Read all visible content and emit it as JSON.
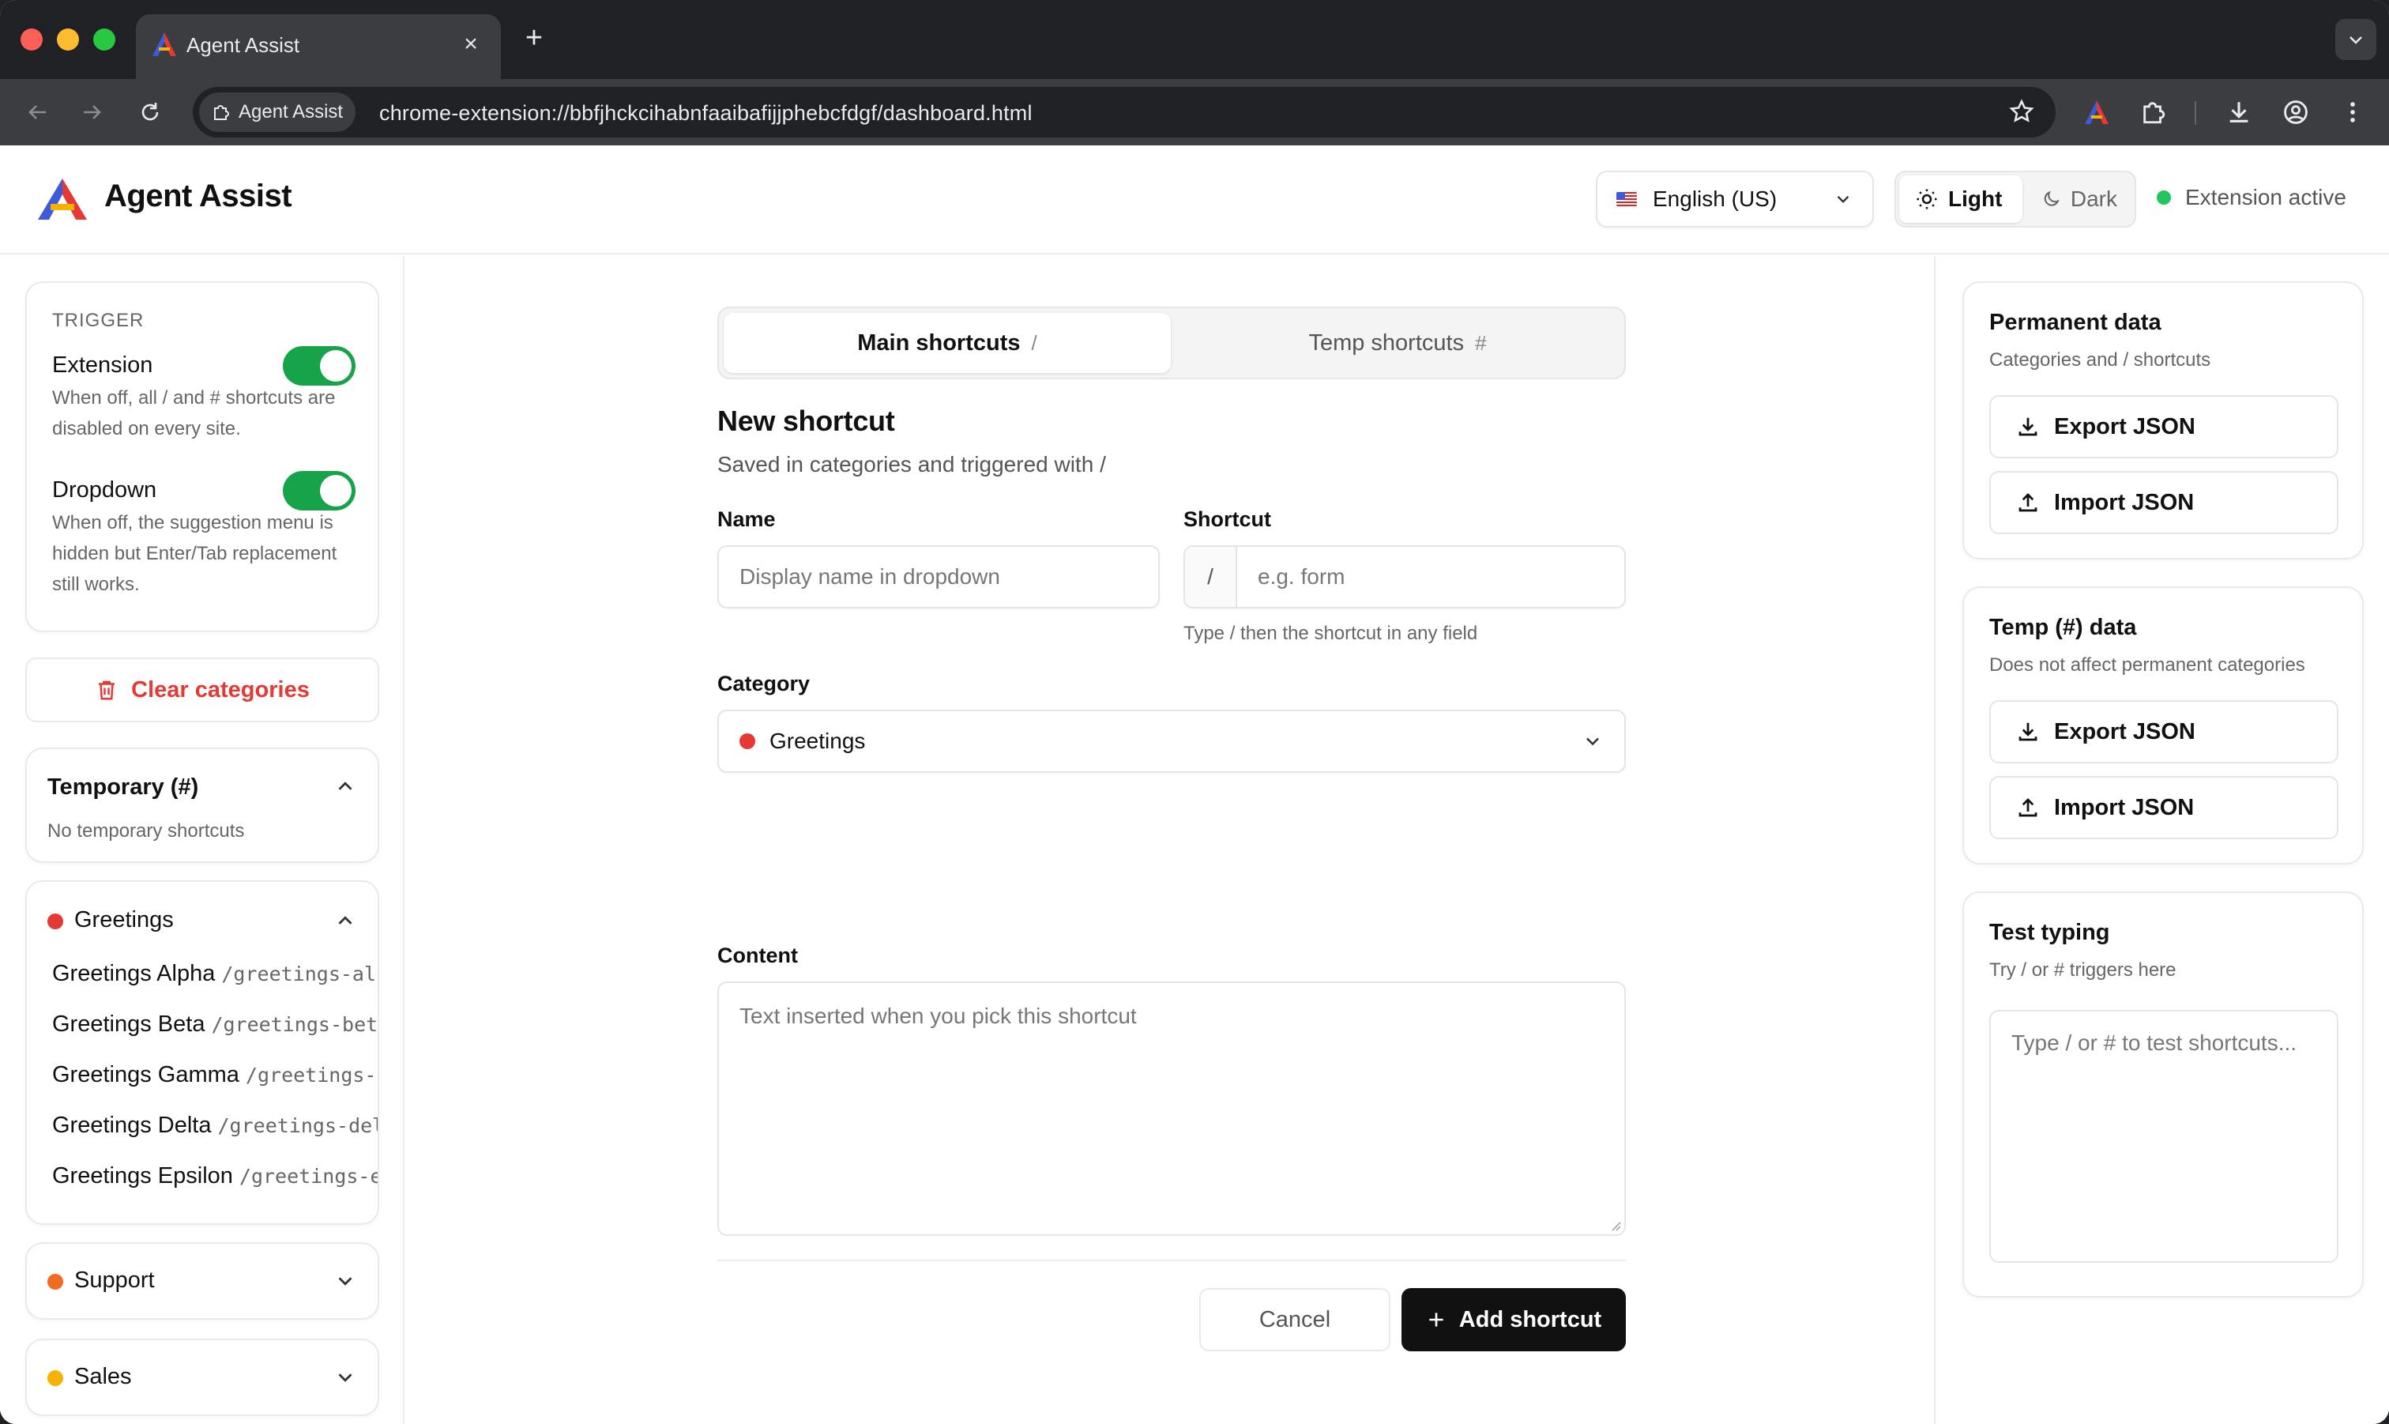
{
  "browser": {
    "tab_title": "Agent Assist",
    "ext_chip_label": "Agent Assist",
    "url": "chrome-extension://bbfjhckcihabnfaaibafijjphebcfdgf/dashboard.html"
  },
  "header": {
    "brand": "Agent Assist",
    "language": "English (US)",
    "theme_light": "Light",
    "theme_dark": "Dark",
    "status": "Extension active"
  },
  "sidebar": {
    "trigger_caption": "TRIGGER",
    "extension_label": "Extension",
    "extension_desc": "When off, all / and # shortcuts are disabled on every site.",
    "dropdown_label": "Dropdown",
    "dropdown_desc": "When off, the suggestion menu is hidden but Enter/Tab replacement still works.",
    "clear_label": "Clear categories",
    "temporary": {
      "title": "Temporary (#)",
      "empty": "No temporary shortcuts"
    },
    "categories": [
      {
        "name": "Greetings",
        "color": "#e53935",
        "expanded": true,
        "items": [
          {
            "name": "Greetings Alpha",
            "code": "/greetings-alpha"
          },
          {
            "name": "Greetings Beta",
            "code": "/greetings-beta"
          },
          {
            "name": "Greetings Gamma",
            "code": "/greetings-gamma"
          },
          {
            "name": "Greetings Delta",
            "code": "/greetings-delta"
          },
          {
            "name": "Greetings Epsilon",
            "code": "/greetings-epsilon"
          }
        ]
      },
      {
        "name": "Support",
        "color": "#f26b21",
        "expanded": false
      },
      {
        "name": "Sales",
        "color": "#f5b301",
        "expanded": false
      }
    ]
  },
  "main": {
    "tabs": [
      {
        "label": "Main shortcuts",
        "symbol": "/",
        "active": true
      },
      {
        "label": "Temp shortcuts",
        "symbol": "#",
        "active": false
      }
    ],
    "title": "New shortcut",
    "subtitle": "Saved in categories and triggered with /",
    "name_label": "Name",
    "name_placeholder": "Display name in dropdown",
    "shortcut_label": "Shortcut",
    "shortcut_prefix": "/",
    "shortcut_placeholder": "e.g. form",
    "shortcut_hint": "Type / then the shortcut in any field",
    "category_label": "Category",
    "category_value": "Greetings",
    "category_color": "#e53935",
    "content_label": "Content",
    "content_placeholder": "Text inserted when you pick this shortcut",
    "cancel_label": "Cancel",
    "add_label": "Add shortcut"
  },
  "right": {
    "permanent": {
      "title": "Permanent data",
      "subtitle": "Categories and / shortcuts",
      "export_label": "Export JSON",
      "import_label": "Import JSON"
    },
    "temp": {
      "title": "Temp (#) data",
      "subtitle": "Does not affect permanent categories",
      "export_label": "Export JSON",
      "import_label": "Import JSON"
    },
    "test": {
      "title": "Test typing",
      "subtitle": "Try / or # triggers here",
      "placeholder": "Type / or # to test shortcuts..."
    }
  }
}
